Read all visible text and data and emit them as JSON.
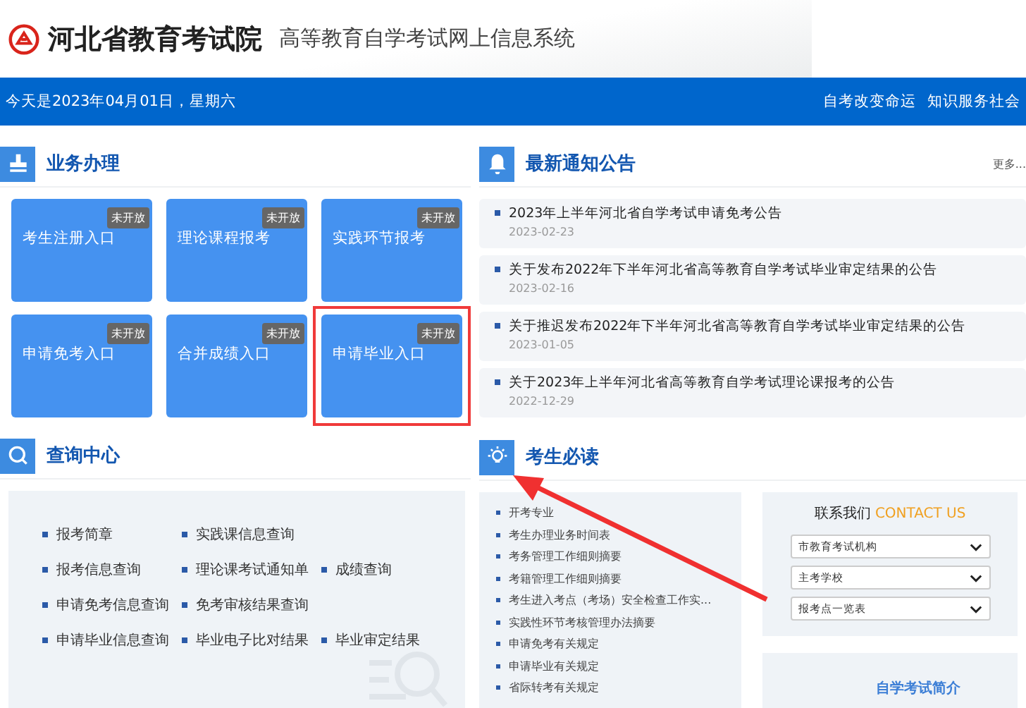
{
  "header": {
    "org": "河北省教育考试院",
    "system": "高等教育自学考试网上信息系统"
  },
  "top_bar": {
    "date": "今天是2023年04月01日，星期六",
    "links": [
      "自考改变命运",
      "知识服务社会"
    ]
  },
  "business": {
    "title": "业务办理",
    "tiles": [
      {
        "label": "考生注册入口",
        "badge": "未开放",
        "highlighted": false
      },
      {
        "label": "理论课程报考",
        "badge": "未开放",
        "highlighted": false
      },
      {
        "label": "实践环节报考",
        "badge": "未开放",
        "highlighted": false
      },
      {
        "label": "申请免考入口",
        "badge": "未开放",
        "highlighted": false
      },
      {
        "label": "合并成绩入口",
        "badge": "未开放",
        "highlighted": false
      },
      {
        "label": "申请毕业入口",
        "badge": "未开放",
        "highlighted": true
      }
    ]
  },
  "notices": {
    "title": "最新通知公告",
    "more": "更多...",
    "items": [
      {
        "title": "2023年上半年河北省自学考试申请免考公告",
        "date": "2023-02-23"
      },
      {
        "title": "关于发布2022年下半年河北省高等教育自学考试毕业审定结果的公告",
        "date": "2023-02-16"
      },
      {
        "title": "关于推迟发布2022年下半年河北省高等教育自学考试毕业审定结果的公告",
        "date": "2023-01-05"
      },
      {
        "title": "关于2023年上半年河北省高等教育自学考试理论课报考的公告",
        "date": "2022-12-29"
      }
    ]
  },
  "query": {
    "title": "查询中心",
    "rows": [
      [
        "报考简章",
        "实践课信息查询"
      ],
      [
        "报考信息查询",
        "理论课考试通知单",
        "成绩查询"
      ],
      [
        "申请免考信息查询",
        "免考审核结果查询"
      ],
      [
        "申请毕业信息查询",
        "毕业电子比对结果",
        "毕业审定结果"
      ]
    ]
  },
  "must_read": {
    "title": "考生必读",
    "items": [
      "开考专业",
      "考生办理业务时间表",
      "考务管理工作细则摘要",
      "考籍管理工作细则摘要",
      "考生进入考点（考场）安全检查工作实...",
      "实践性环节考核管理办法摘要",
      "申请免考有关规定",
      "申请毕业有关规定",
      "省际转考有关规定"
    ]
  },
  "contact": {
    "title": "联系我们",
    "title_en": "CONTACT US",
    "selects": [
      "市教育考试机构",
      "主考学校",
      "报考点一览表"
    ]
  },
  "intro": {
    "title": "自学考试简介"
  }
}
